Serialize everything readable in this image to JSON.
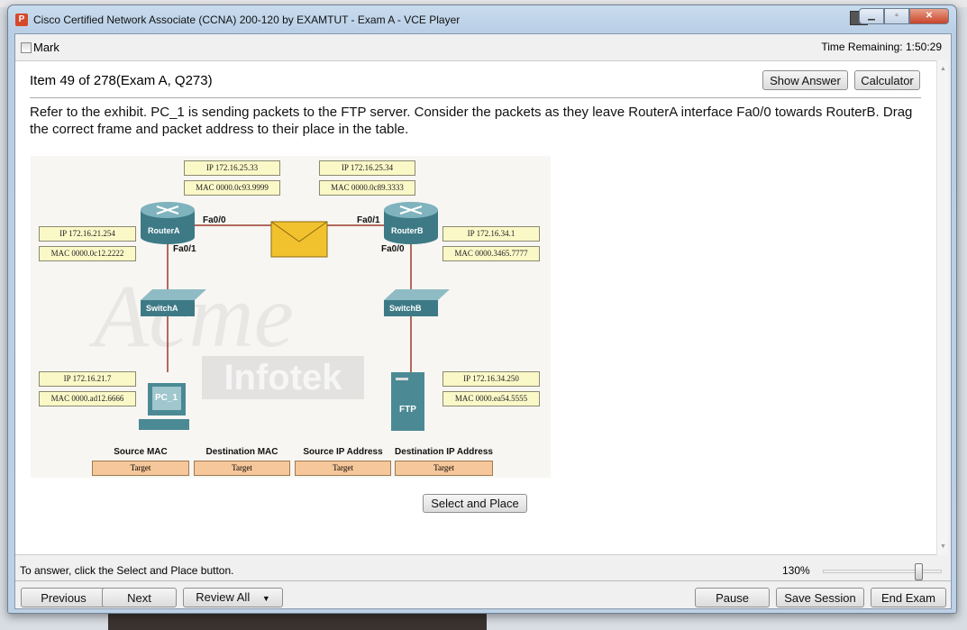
{
  "window": {
    "title": "Cisco Certified Network Associate (CCNA) 200-120 by EXAMTUT - Exam A - VCE Player",
    "app_icon": "P"
  },
  "toolbar": {
    "mark_label": "Mark",
    "time_remaining": "Time Remaining: 1:50:29"
  },
  "question": {
    "item": "Item 49 of 278(Exam A, Q273)",
    "show_answer": "Show Answer",
    "calculator": "Calculator",
    "text": "Refer to the exhibit. PC_1 is sending packets to the FTP server. Consider the packets as they leave RouterA interface Fa0/0 towards RouterB. Drag the correct frame and packet address to their place in the table.",
    "select_and_place": "Select and Place"
  },
  "exhibit": {
    "watermark": "Acme Infotek",
    "routerA": {
      "name": "RouterA",
      "fa00": "Fa0/0",
      "fa01": "Fa0/1",
      "fa00_ip": "IP 172.16.25.33",
      "fa00_mac": "MAC 0000.0c93.9999",
      "fa01_ip": "IP 172.16.21.254",
      "fa01_mac": "MAC 0000.0c12.2222"
    },
    "routerB": {
      "name": "RouterB",
      "fa01": "Fa0/1",
      "fa00": "Fa0/0",
      "fa01_ip": "IP 172.16.25.34",
      "fa01_mac": "MAC 0000.0c89.3333",
      "fa00_ip": "IP 172.16.34.1",
      "fa00_mac": "MAC 0000.3465.7777"
    },
    "switchA": "SwitchA",
    "switchB": "SwitchB",
    "pc": {
      "name": "PC_1",
      "ip": "IP 172.16.21.7",
      "mac": "MAC 0000.ad12.6666"
    },
    "ftp": {
      "name": "FTP",
      "ip": "IP 172.16.34.250",
      "mac": "MAC 0000.ea54.5555"
    },
    "columns": [
      "Source MAC",
      "Destination MAC",
      "Source IP Address",
      "Destination IP Address"
    ],
    "target": "Target"
  },
  "statusbar": {
    "hint": "To answer, click the Select and Place button.",
    "zoom": "130%",
    "zoom_value": 130
  },
  "nav": {
    "previous": "Previous",
    "next": "Next",
    "review_all": "Review All",
    "pause": "Pause",
    "save_session": "Save Session",
    "end_exam": "End Exam"
  }
}
